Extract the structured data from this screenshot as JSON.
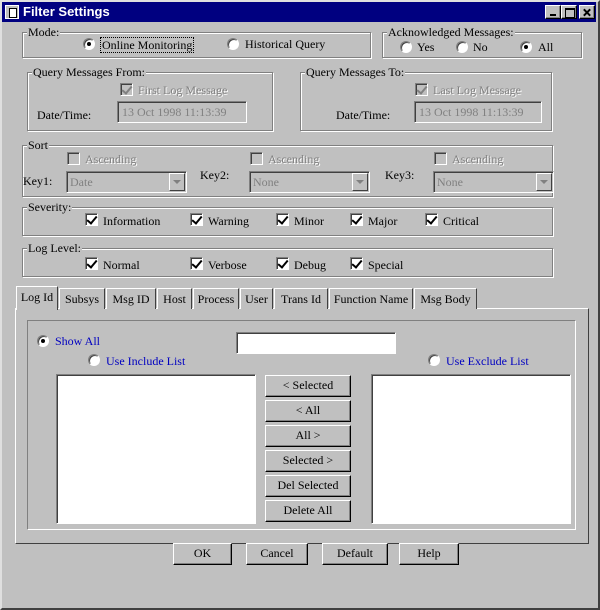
{
  "window": {
    "title": "Filter Settings"
  },
  "mode": {
    "legend": "Mode:",
    "options": [
      {
        "label": "Online Monitoring",
        "selected": true
      },
      {
        "label": "Historical Query",
        "selected": false
      }
    ]
  },
  "ack": {
    "legend": "Acknowledged Messages:",
    "options": [
      {
        "label": "Yes",
        "selected": false
      },
      {
        "label": "No",
        "selected": false
      },
      {
        "label": "All",
        "selected": true
      }
    ]
  },
  "from": {
    "legend": "Query Messages From:",
    "check_label": "First Log Message",
    "checked": true,
    "dt_label": "Date/Time:",
    "dt_value": "13 Oct 1998 11:13:39"
  },
  "to": {
    "legend": "Query Messages To:",
    "check_label": "Last Log Message",
    "checked": true,
    "dt_label": "Date/Time:",
    "dt_value": "13 Oct 1998 11:13:39"
  },
  "sort": {
    "legend": "Sort",
    "ascending_label": "Ascending",
    "keys": [
      {
        "label": "Key1:",
        "value": "Date"
      },
      {
        "label": "Key2:",
        "value": "None"
      },
      {
        "label": "Key3:",
        "value": "None"
      }
    ]
  },
  "severity": {
    "legend": "Severity:",
    "items": [
      "Information",
      "Warning",
      "Minor",
      "Major",
      "Critical"
    ]
  },
  "loglevel": {
    "legend": "Log Level:",
    "items": [
      "Normal",
      "Verbose",
      "Debug",
      "Special"
    ]
  },
  "tabs": [
    "Log Id",
    "Subsys",
    "Msg ID",
    "Host",
    "Process",
    "User",
    "Trans Id",
    "Function Name",
    "Msg Body"
  ],
  "active_tab": "Log Id",
  "logid": {
    "show_all": "Show All",
    "use_include": "Use Include List",
    "use_exclude": "Use Exclude List",
    "input_value": "",
    "buttons": [
      "< Selected",
      "< All",
      "All >",
      "Selected >",
      "Del Selected",
      "Delete All"
    ]
  },
  "footer": {
    "buttons": [
      "OK",
      "Cancel",
      "Default",
      "Help"
    ]
  },
  "colors": {
    "title_bar": "#000080",
    "face": "#c0c0c0",
    "link_text": "#0000c0"
  }
}
